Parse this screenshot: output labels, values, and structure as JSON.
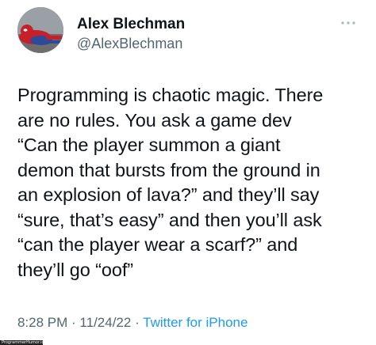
{
  "author": {
    "display_name": "Alex Blechman",
    "handle": "@AlexBlechman",
    "avatar_icon": "spider-man-avatar"
  },
  "menu": {
    "icon": "more-options-icon"
  },
  "tweet": {
    "lines": [
      "Programming is chaotic magic. There",
      "are no rules. You ask a game dev",
      "“Can the player summon a giant",
      "demon that bursts from the ground in",
      "an explosion of lava?” and they’ll say",
      "“sure, that’s easy” and then you’ll ask",
      "“can the player wear a scarf?” and",
      "they’ll go “oof”"
    ]
  },
  "meta": {
    "time": "8:28 PM",
    "sep1": " · ",
    "date": "11/24/22",
    "sep2": " · ",
    "source": "Twitter for iPhone"
  },
  "watermark": {
    "text": "ProgrammerHumor.io"
  },
  "colors": {
    "text": "#0f1419",
    "secondary": "#536471",
    "link": "#1d9bf0",
    "background": "#ffffff"
  }
}
